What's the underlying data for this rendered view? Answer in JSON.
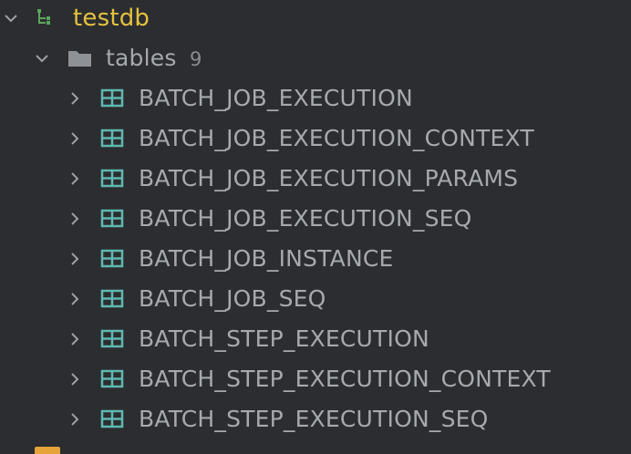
{
  "tree": {
    "database": {
      "name": "testdb",
      "icon": "database-schema-icon",
      "expanded": true,
      "color": "#e6c13d"
    },
    "tables_folder": {
      "label": "tables",
      "count": "9",
      "icon": "folder-icon",
      "expanded": true
    },
    "tables": [
      {
        "name": "BATCH_JOB_EXECUTION"
      },
      {
        "name": "BATCH_JOB_EXECUTION_CONTEXT"
      },
      {
        "name": "BATCH_JOB_EXECUTION_PARAMS"
      },
      {
        "name": "BATCH_JOB_EXECUTION_SEQ"
      },
      {
        "name": "BATCH_JOB_INSTANCE"
      },
      {
        "name": "BATCH_JOB_SEQ"
      },
      {
        "name": "BATCH_STEP_EXECUTION"
      },
      {
        "name": "BATCH_STEP_EXECUTION_CONTEXT"
      },
      {
        "name": "BATCH_STEP_EXECUTION_SEQ"
      }
    ],
    "table_icon_color": "#5fb8b0",
    "folder_color": "#8e9196"
  }
}
